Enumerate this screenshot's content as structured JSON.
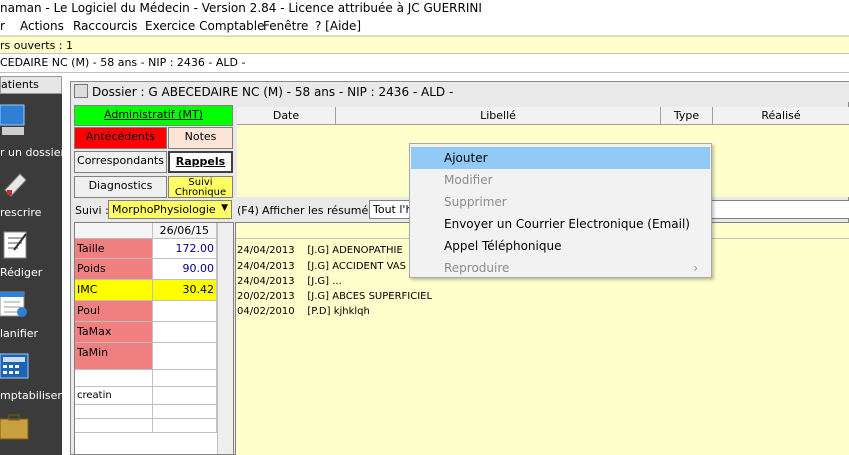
{
  "window": {
    "title": "naman - Le Logiciel du Médecin - Version 2.84 - Licence attribuée à JC GUERRINI"
  },
  "menu": [
    "r",
    "Actions",
    "Raccourcis",
    "Exercice Comptable",
    "Fenêtre",
    "? [Aide]"
  ],
  "status": {
    "open_files": "rs ouverts : 1",
    "patient_line": "CEDAIRE NC (M) -  58 ans - NIP : 2436 - ALD -"
  },
  "toolbar": {
    "header": "atients",
    "items": [
      {
        "label": "r un dossier",
        "icon": "computer-icon"
      },
      {
        "label": "rescrire",
        "icon": "prescription-icon"
      },
      {
        "label": "Rédiger",
        "icon": "write-icon"
      },
      {
        "label": "lanifier",
        "icon": "calendar-icon"
      },
      {
        "label": "mptabiliser",
        "icon": "calculator-icon"
      },
      {
        "label": "",
        "icon": "briefcase-icon"
      }
    ]
  },
  "dossier": {
    "title": "Dossier : G  ABECEDAIRE NC (M) -  58 ans - NIP : 2436 - ALD -",
    "tabs": {
      "administratif": "Administratif (MT)",
      "antecedents": "Antécédents",
      "notes": "Notes",
      "correspondants": "Correspondants",
      "rappels": "Rappels",
      "diagnostics": "Diagnostics",
      "suivi_chronique_line1": "Suivi",
      "suivi_chronique_line2": "Chronique"
    },
    "columns": [
      "Date",
      "Libellé",
      "Type",
      "Réalisé"
    ],
    "suivi_label": "Suivi :",
    "suivi_value": "MorphoPhysiologie",
    "f4_label": "(F4)",
    "afficher_label": "Afficher les résumés :",
    "afficher_value": "Tout l'h",
    "grid_date": "26/06/15",
    "measures": [
      {
        "name": "Taille",
        "value": "172.00"
      },
      {
        "name": "Poids",
        "value": "90.00"
      },
      {
        "name": "IMC",
        "value": "30.42"
      },
      {
        "name": "Poul",
        "value": ""
      },
      {
        "name": "TaMax",
        "value": ""
      },
      {
        "name": "TaMin",
        "value": ""
      },
      {
        "name": "",
        "value": ""
      },
      {
        "name": "creatin",
        "value": ""
      },
      {
        "name": "",
        "value": ""
      },
      {
        "name": "",
        "value": ""
      }
    ],
    "results": [
      {
        "date": "24/04/2013",
        "author": "[J.G]",
        "text": "ADENOPATHIE"
      },
      {
        "date": "24/04/2013",
        "author": "[J.G]",
        "text": "ACCIDENT VAS"
      },
      {
        "date": "24/04/2013",
        "author": "[J.G]",
        "text": "..."
      },
      {
        "date": "20/02/2013",
        "author": "[J.G]",
        "text": "ABCES SUPERFICIEL"
      },
      {
        "date": "04/02/2010",
        "author": "[P.D]",
        "text": "kjhklqh"
      }
    ]
  },
  "context_menu": {
    "items": [
      {
        "label": "Ajouter",
        "state": "highlighted"
      },
      {
        "label": "Modifier",
        "state": "disabled"
      },
      {
        "label": "Supprimer",
        "state": "disabled"
      },
      {
        "label": "Envoyer un Courrier Electronique (Email)",
        "state": "enabled"
      },
      {
        "label": "Appel Téléphonique",
        "state": "enabled"
      },
      {
        "label": "Reproduire",
        "state": "disabled",
        "submenu_arrow": "›"
      }
    ]
  },
  "colors": {
    "yellow_panel": "#ffffcc",
    "green_tab": "#00ff00",
    "red_tab": "#ff0000",
    "notes_tab": "#fce4d6",
    "measure_red": "#f08080",
    "imc_yellow": "#ffff00",
    "menu_highlight": "#91c9f7"
  }
}
